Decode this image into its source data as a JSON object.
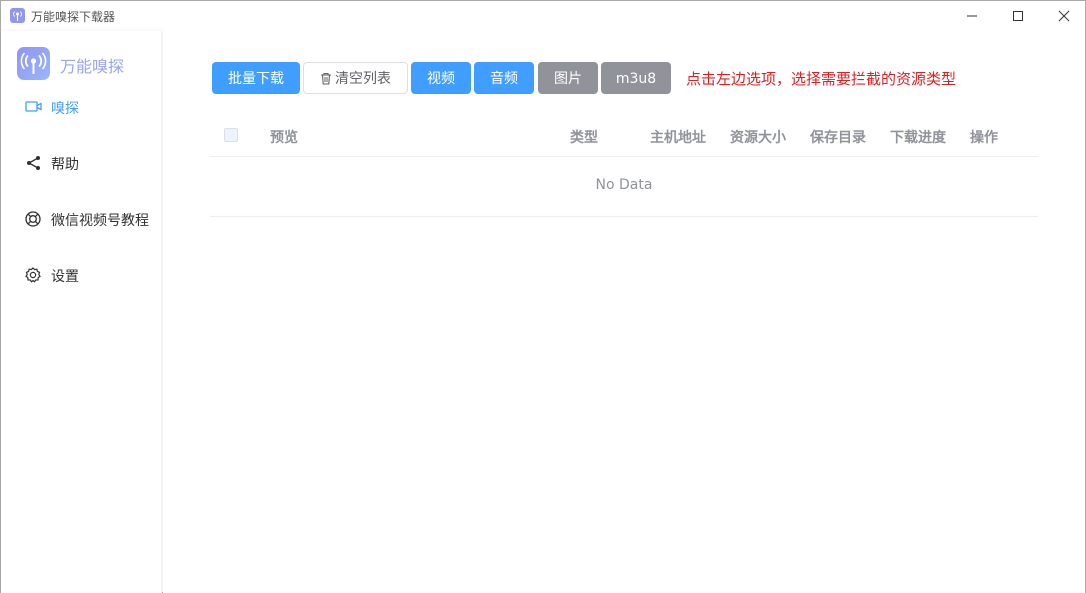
{
  "window": {
    "title": "万能嗅探下载器",
    "icon": "antenna-icon"
  },
  "sidebar": {
    "brand": "万能嗅探",
    "items": [
      {
        "label": "嗅探",
        "icon": "video-camera-icon",
        "active": true
      },
      {
        "label": "帮助",
        "icon": "share-icon",
        "active": false
      },
      {
        "label": "微信视频号教程",
        "icon": "lifebuoy-icon",
        "active": false
      },
      {
        "label": "设置",
        "icon": "gear-icon",
        "active": false
      }
    ]
  },
  "toolbar": {
    "batch_download": "批量下载",
    "clear_list": "清空列表",
    "video": "视频",
    "audio": "音频",
    "image": "图片",
    "m3u8": "m3u8",
    "hint": "点击左边选项，选择需要拦截的资源类型"
  },
  "table": {
    "columns": [
      "预览",
      "类型",
      "主机地址",
      "资源大小",
      "保存目录",
      "下载进度",
      "操作"
    ],
    "empty_text": "No Data"
  },
  "colors": {
    "primary": "#409eff",
    "inactive": "#909399",
    "hint": "#e02020",
    "brand": "#9aa3f2"
  }
}
